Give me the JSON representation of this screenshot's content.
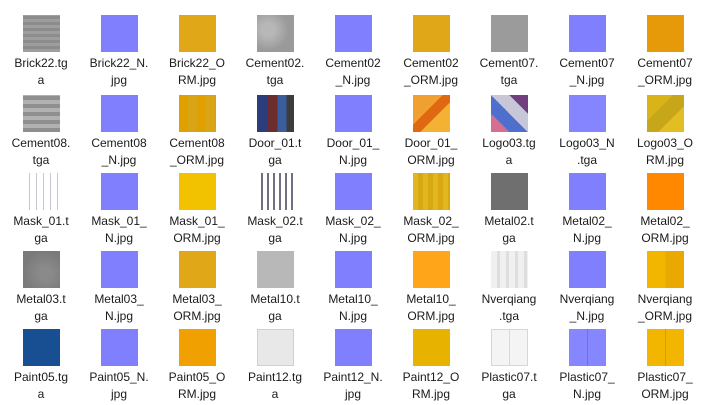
{
  "files": [
    {
      "name": "Brick22.tga",
      "thumb": "t-brick"
    },
    {
      "name": "Brick22_N.jpg",
      "thumb": "t-normal"
    },
    {
      "name": "Brick22_ORM.jpg",
      "thumb": "t-orm"
    },
    {
      "name": "Cement02.tga",
      "thumb": "t-cement"
    },
    {
      "name": "Cement02_N.jpg",
      "thumb": "t-normal"
    },
    {
      "name": "Cement02_ORM.jpg",
      "thumb": "t-orm"
    },
    {
      "name": "Cement07.tga",
      "thumb": "t-cement7"
    },
    {
      "name": "Cement07_N.jpg",
      "thumb": "t-normal"
    },
    {
      "name": "Cement07_ORM.jpg",
      "thumb": "t-orm2"
    },
    {
      "name": "Cement08.tga",
      "thumb": "t-stripes"
    },
    {
      "name": "Cement08_N.jpg",
      "thumb": "t-normal"
    },
    {
      "name": "Cement08_ORM.jpg",
      "thumb": "t-orm3"
    },
    {
      "name": "Door_01.tga",
      "thumb": "t-door"
    },
    {
      "name": "Door_01_N.jpg",
      "thumb": "t-normal"
    },
    {
      "name": "Door_01_ORM.jpg",
      "thumb": "t-doororm"
    },
    {
      "name": "Logo03.tga",
      "thumb": "t-logo"
    },
    {
      "name": "Logo03_N.tga",
      "thumb": "t-normal2"
    },
    {
      "name": "Logo03_ORM.jpg",
      "thumb": "t-logoorm"
    },
    {
      "name": "Mask_01.tga",
      "thumb": "t-mask"
    },
    {
      "name": "Mask_01_N.jpg",
      "thumb": "t-normal"
    },
    {
      "name": "Mask_01_ORM.jpg",
      "thumb": "t-yellow"
    },
    {
      "name": "Mask_02.tga",
      "thumb": "t-mask2"
    },
    {
      "name": "Mask_02_N.jpg",
      "thumb": "t-normal"
    },
    {
      "name": "Mask_02_ORM.jpg",
      "thumb": "t-mask2orm"
    },
    {
      "name": "Metal02.tga",
      "thumb": "t-metal"
    },
    {
      "name": "Metal02_N.jpg",
      "thumb": "t-normal"
    },
    {
      "name": "Metal02_ORM.jpg",
      "thumb": "t-orange"
    },
    {
      "name": "Metal03.tga",
      "thumb": "t-metal3"
    },
    {
      "name": "Metal03_N.jpg",
      "thumb": "t-normal"
    },
    {
      "name": "Metal03_ORM.jpg",
      "thumb": "t-orm"
    },
    {
      "name": "Metal10.tga",
      "thumb": "t-metal10"
    },
    {
      "name": "Metal10_N.jpg",
      "thumb": "t-normal"
    },
    {
      "name": "Metal10_ORM.jpg",
      "thumb": "t-orm10"
    },
    {
      "name": "Nverqiang.tga",
      "thumb": "t-nver"
    },
    {
      "name": "Nverqiang_N.jpg",
      "thumb": "t-normal"
    },
    {
      "name": "Nverqiang_ORM.jpg",
      "thumb": "t-nverorm"
    },
    {
      "name": "Paint05.tga",
      "thumb": "t-paint5"
    },
    {
      "name": "Paint05_N.jpg",
      "thumb": "t-normal"
    },
    {
      "name": "Paint05_ORM.jpg",
      "thumb": "t-orm5"
    },
    {
      "name": "Paint12.tga",
      "thumb": "t-white"
    },
    {
      "name": "Paint12_N.jpg",
      "thumb": "t-normal"
    },
    {
      "name": "Paint12_ORM.jpg",
      "thumb": "t-paint12orm"
    },
    {
      "name": "Plastic07.tga",
      "thumb": "t-plastic"
    },
    {
      "name": "Plastic07_N.jpg",
      "thumb": "t-plasticN"
    },
    {
      "name": "Plastic07_ORM.jpg",
      "thumb": "t-plasticorm"
    }
  ],
  "captions": [
    "Brick22.tg\na",
    "Brick22_N.\njpg",
    "Brick22_O\nRM.jpg",
    "Cement02.\ntga",
    "Cement02\n_N.jpg",
    "Cement02\n_ORM.jpg",
    "Cement07.\ntga",
    "Cement07\n_N.jpg",
    "Cement07\n_ORM.jpg",
    "Cement08.\ntga",
    "Cement08\n_N.jpg",
    "Cement08\n_ORM.jpg",
    "Door_01.t\nga",
    "Door_01_\nN.jpg",
    "Door_01_\nORM.jpg",
    "Logo03.tg\na",
    "Logo03_N\n.tga",
    "Logo03_O\nRM.jpg",
    "Mask_01.t\nga",
    "Mask_01_\nN.jpg",
    "Mask_01_\nORM.jpg",
    "Mask_02.t\nga",
    "Mask_02_\nN.jpg",
    "Mask_02_\nORM.jpg",
    "Metal02.t\nga",
    "Metal02_\nN.jpg",
    "Metal02_\nORM.jpg",
    "Metal03.t\nga",
    "Metal03_\nN.jpg",
    "Metal03_\nORM.jpg",
    "Metal10.t\nga",
    "Metal10_\nN.jpg",
    "Metal10_\nORM.jpg",
    "Nverqiang\n.tga",
    "Nverqiang\n_N.jpg",
    "Nverqiang\n_ORM.jpg",
    "Paint05.tg\na",
    "Paint05_N.\njpg",
    "Paint05_O\nRM.jpg",
    "Paint12.tg\na",
    "Paint12_N.\njpg",
    "Paint12_O\nRM.jpg",
    "Plastic07.t\nga",
    "Plastic07_\nN.jpg",
    "Plastic07_\nORM.jpg"
  ]
}
